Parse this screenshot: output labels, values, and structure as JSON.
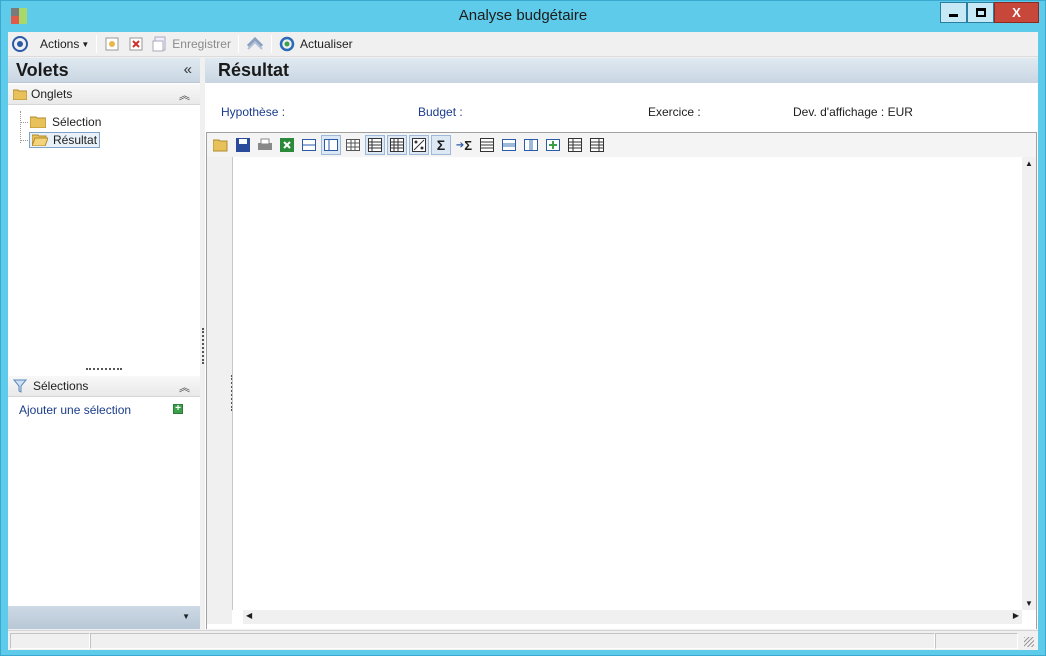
{
  "window": {
    "title": "Analyse budgétaire",
    "minimize": "–",
    "maximize": "□",
    "close": "X"
  },
  "toolbar": {
    "actions_label": "Actions",
    "save_label": "Enregistrer",
    "refresh_label": "Actualiser"
  },
  "left_pane": {
    "title": "Volets",
    "collapse_glyph": "«",
    "tabs_section": {
      "title": "Onglets",
      "items": [
        {
          "label": "Sélection"
        },
        {
          "label": "Résultat"
        }
      ]
    },
    "selections_section": {
      "title": "Sélections",
      "add_label": "Ajouter une sélection"
    }
  },
  "right_pane": {
    "title": "Résultat",
    "fields": {
      "hypothese": "Hypothèse :",
      "budget": "Budget :",
      "exercice": "Exercice :",
      "devise": "Dev. d'affichage : EUR"
    }
  },
  "colors": {
    "frame": "#5ecbea",
    "header": "#c9d6e2",
    "link": "#1a3c8c",
    "folder": "#e8c15a"
  }
}
